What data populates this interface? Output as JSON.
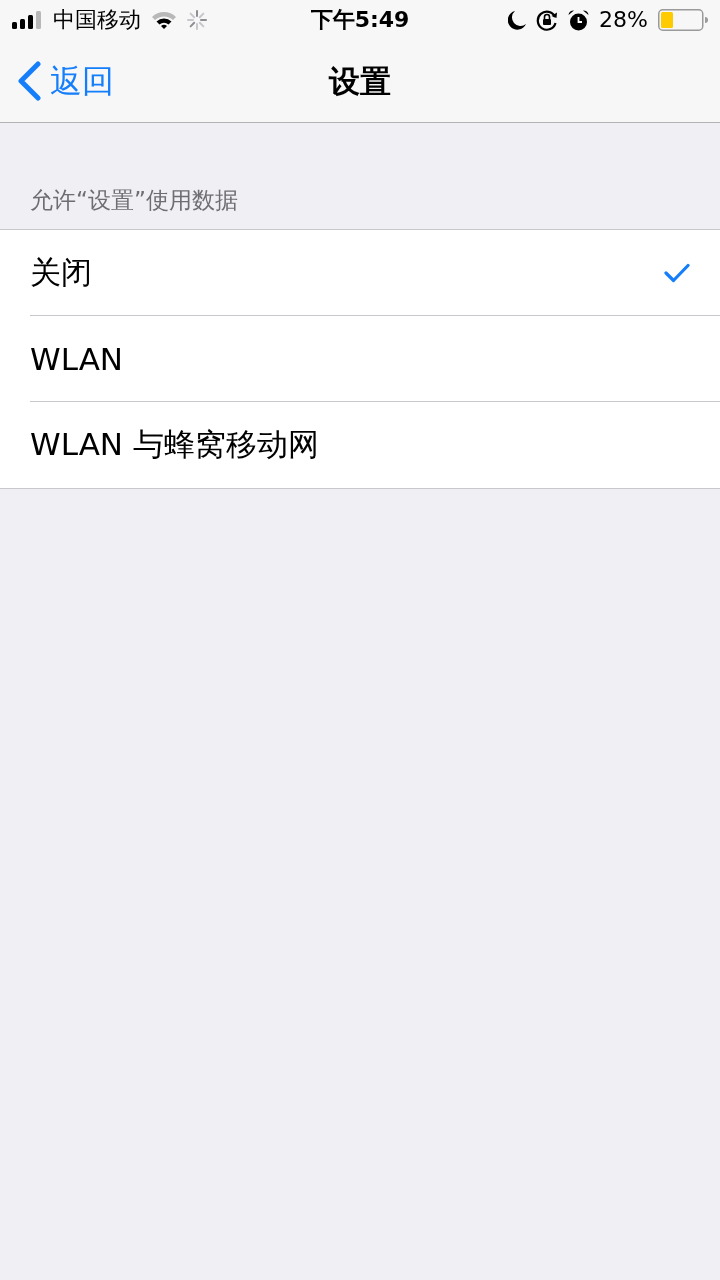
{
  "status_bar": {
    "carrier": "中国移动",
    "time": "下午5:49",
    "battery_text": "28%"
  },
  "nav_bar": {
    "back": "返回",
    "title": "设置"
  },
  "section": {
    "header": "允许“设置”使用数据",
    "options": [
      {
        "label": "关闭",
        "selected": true
      },
      {
        "label": "WLAN",
        "selected": false
      },
      {
        "label": "WLAN 与蜂窝移动网",
        "selected": false
      }
    ]
  }
}
